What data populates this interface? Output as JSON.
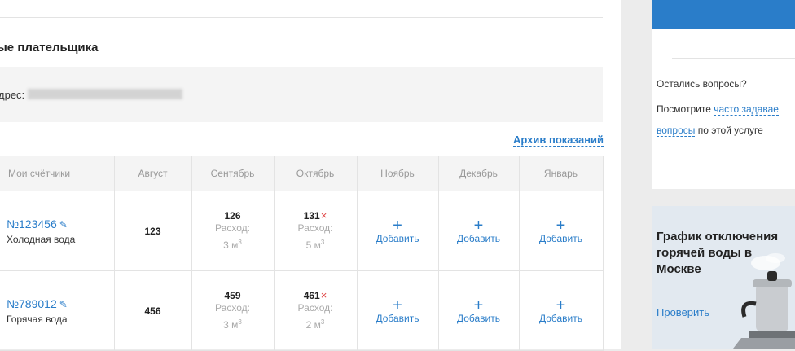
{
  "section_title": "ые плательщика",
  "address_label": "дрес:",
  "archive_link": "Архив показаний",
  "table": {
    "headers": [
      "Мои счётчики",
      "Август",
      "Сентябрь",
      "Октябрь",
      "Ноябрь",
      "Декабрь",
      "Январь"
    ],
    "consumption_label": "Расход:",
    "add_label": "Добавить",
    "plus_symbol": "+",
    "remove_symbol": "×",
    "edit_symbol": "✎",
    "rows": [
      {
        "meter_number": "№123456",
        "meter_type": "Холодная вода",
        "august": "123",
        "september": {
          "value": "126",
          "consumption": "3 м"
        },
        "october": {
          "value": "131",
          "consumption": "5 м"
        }
      },
      {
        "meter_number": "№789012",
        "meter_type": "Горячая вода",
        "august": "456",
        "september": {
          "value": "459",
          "consumption": "3 м"
        },
        "october": {
          "value": "461",
          "consumption": "2 м"
        }
      }
    ]
  },
  "unit_sup": "3",
  "sidebar": {
    "faq_line1": "Остались вопросы?",
    "faq_line2_prefix": "Посмотрите ",
    "faq_link_part1": "часто задавае",
    "faq_link_part2": "вопросы",
    "faq_line3_suffix": " по этой услуге",
    "promo_title": "График отключения горячей воды в Москве",
    "promo_link": "Проверить"
  },
  "colors": {
    "accent": "#2a7dc9",
    "remove": "#e04545",
    "promo_bg": "#e2e9f0"
  }
}
